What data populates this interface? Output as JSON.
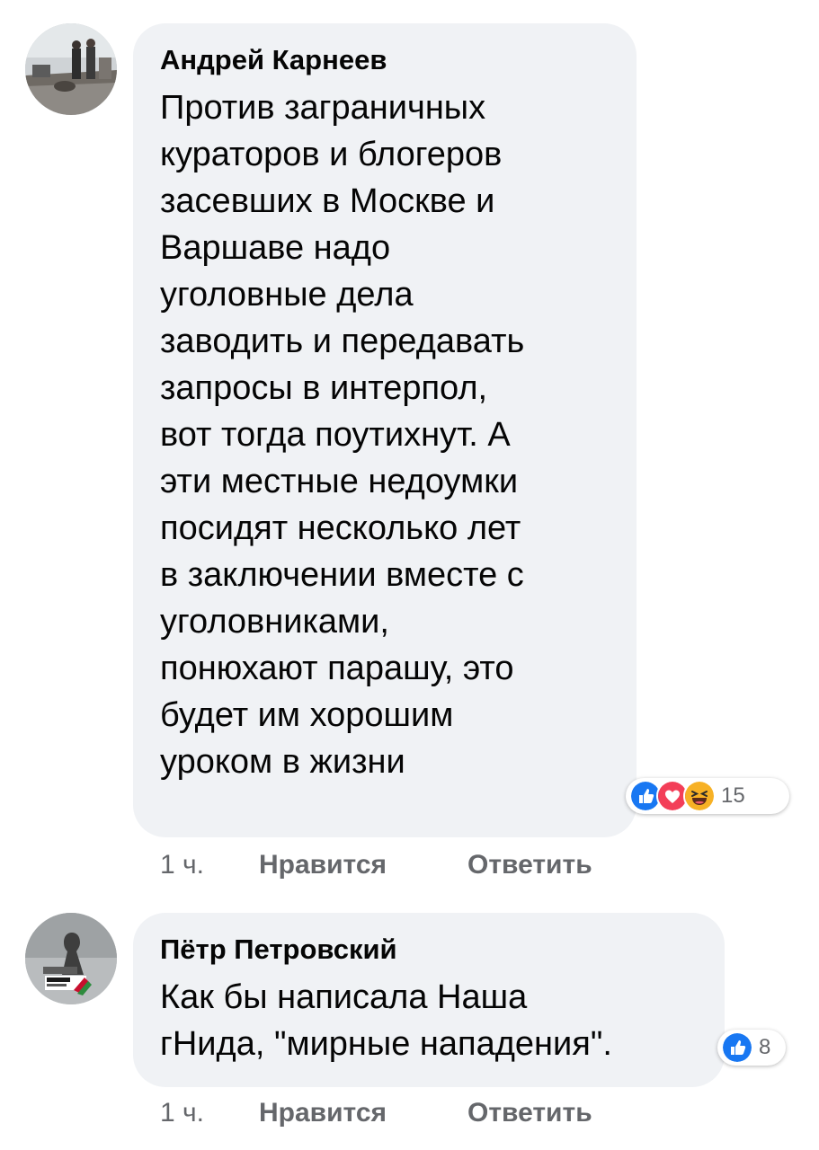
{
  "comments": [
    {
      "author": "Андрей Карнеев",
      "text": "Против заграничных\nкураторов и блогеров\nзасевших в Москве и\nВаршаве надо\nуголовные дела\nзаводить и передавать\nзапросы в интерпол,\nвот тогда поутихнут. А\nэти местные недоумки\nпосидят несколько лет\nв заключении вместе с\nуголовниками,\nпонюхают парашу, это\nбудет им хорошим\nуроком в жизни",
      "reactions": [
        "like-icon",
        "love-icon",
        "haha-icon"
      ],
      "reaction_count": "15",
      "time": "1 ч.",
      "like_label": "Нравится",
      "reply_label": "Ответить"
    },
    {
      "author": "Пётр Петровский",
      "text": "Как бы написала Наша\nгНида, \"мирные нападения\".",
      "reactions": [
        "like-icon"
      ],
      "reaction_count": "8",
      "time": "1 ч.",
      "like_label": "Нравится",
      "reply_label": "Ответить"
    }
  ],
  "colors": {
    "bubble": "#f0f2f5",
    "like": "#1877f2",
    "love": "#f33e58",
    "haha": "#f7b125",
    "meta": "#65676b"
  }
}
